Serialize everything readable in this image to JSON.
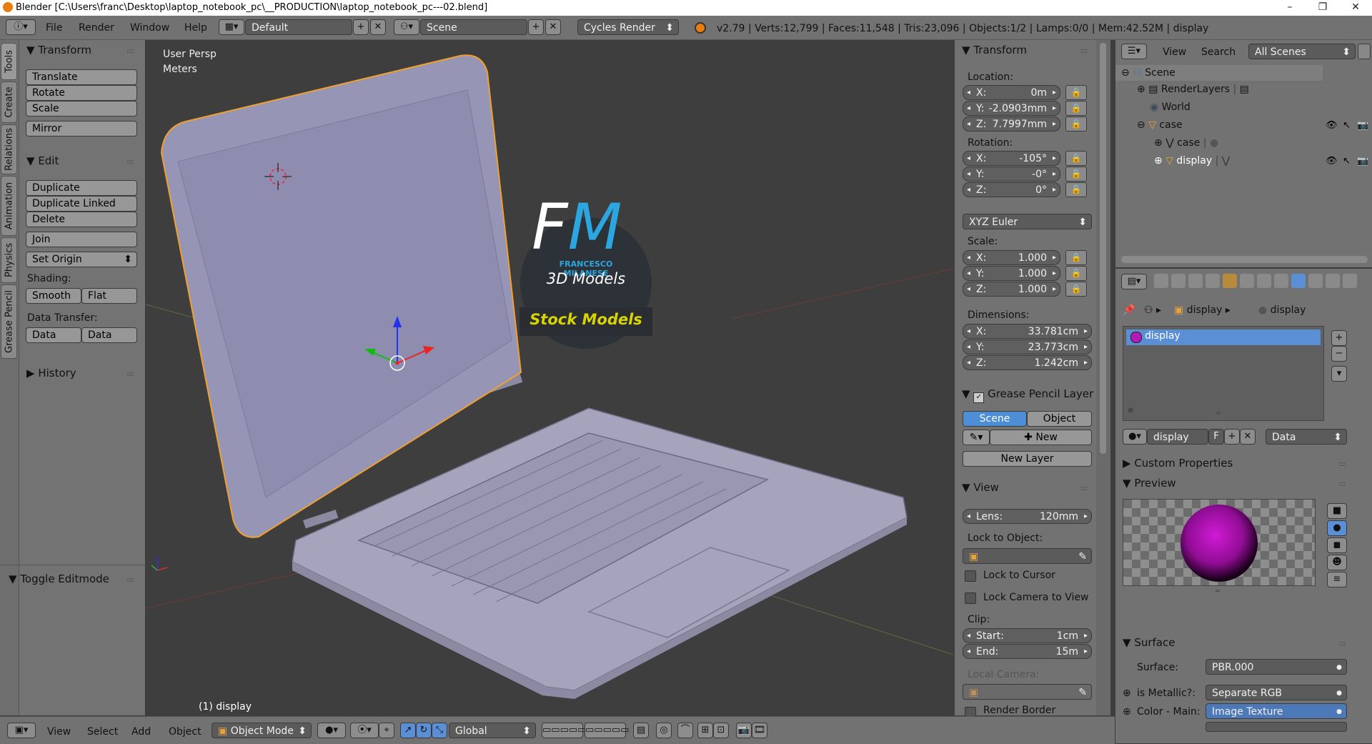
{
  "window": {
    "title": "Blender [C:\\Users\\franc\\Desktop\\laptop_notebook_pc\\__PRODUCTION\\laptop_notebook_pc---02.blend]",
    "controls": [
      "–",
      "❐",
      "✕"
    ]
  },
  "topbar": {
    "menus": [
      "File",
      "Render",
      "Window",
      "Help"
    ],
    "layout": "Default",
    "scene": "Scene",
    "engine": "Cycles Render",
    "stats": "v2.79 | Verts:12,799 | Faces:11,548 | Tris:23,096 | Objects:1/2 | Lamps:0/0 | Mem:42.52M | display"
  },
  "tabs": [
    "Tools",
    "Create",
    "Relations",
    "Animation",
    "Physics",
    "Grease Pencil"
  ],
  "toolshelf": {
    "transform_header": "Transform",
    "transform_buttons": [
      "Translate",
      "Rotate",
      "Scale"
    ],
    "mirror": "Mirror",
    "edit_header": "Edit",
    "edit_buttons": [
      "Duplicate",
      "Duplicate Linked",
      "Delete"
    ],
    "join": "Join",
    "set_origin": "Set Origin",
    "shading_label": "Shading:",
    "smooth": "Smooth",
    "flat": "Flat",
    "data_transfer_label": "Data Transfer:",
    "data": "Data",
    "data_layout": "Data Layo",
    "history": "History",
    "toggle_editmode": "Toggle Editmode"
  },
  "viewport": {
    "view_name": "User Persp",
    "units": "Meters",
    "object_label": "(1) display",
    "watermark": {
      "letters_f": "F",
      "letters_m": "M",
      "author": "FRANCESCO MILANESE",
      "subtitle": "3D Models",
      "banner": "Stock Models"
    }
  },
  "npanel": {
    "transform_header": "Transform",
    "location_label": "Location:",
    "location": [
      {
        "axis": "X:",
        "value": "0m"
      },
      {
        "axis": "Y:",
        "value": "-2.0903mm"
      },
      {
        "axis": "Z:",
        "value": "7.7997mm"
      }
    ],
    "rotation_label": "Rotation:",
    "rotation": [
      {
        "axis": "X:",
        "value": "-105°"
      },
      {
        "axis": "Y:",
        "value": "-0°"
      },
      {
        "axis": "Z:",
        "value": "0°"
      }
    ],
    "rotation_mode": "XYZ Euler",
    "scale_label": "Scale:",
    "scale": [
      {
        "axis": "X:",
        "value": "1.000"
      },
      {
        "axis": "Y:",
        "value": "1.000"
      },
      {
        "axis": "Z:",
        "value": "1.000"
      }
    ],
    "dimensions_label": "Dimensions:",
    "dimensions": [
      {
        "axis": "X:",
        "value": "33.781cm"
      },
      {
        "axis": "Y:",
        "value": "23.773cm"
      },
      {
        "axis": "Z:",
        "value": "1.242cm"
      }
    ],
    "grease_header": "Grease Pencil Layer",
    "scene_btn": "Scene",
    "object_btn": "Object",
    "new_btn": "New",
    "new_layer_btn": "New Layer",
    "view_header": "View",
    "lens_label": "Lens:",
    "lens_value": "120mm",
    "lock_to_object": "Lock to Object:",
    "lock_to_cursor": "Lock to Cursor",
    "lock_camera": "Lock Camera to View",
    "clip_label": "Clip:",
    "clip_start_label": "Start:",
    "clip_start": "1cm",
    "clip_end_label": "End:",
    "clip_end": "15m",
    "local_camera": "Local Camera:",
    "render_border": "Render Border"
  },
  "outliner": {
    "menus": [
      "View",
      "Search"
    ],
    "filter": "All Scenes",
    "tree": [
      {
        "label": "Scene"
      },
      {
        "label": "RenderLayers"
      },
      {
        "label": "World"
      },
      {
        "label": "case"
      },
      {
        "label": "case"
      },
      {
        "label": "display"
      }
    ]
  },
  "properties": {
    "breadcrumb_object": "display",
    "breadcrumb_material": "display",
    "slot": "display",
    "material_name": "display",
    "material_f": "F",
    "link": "Data",
    "custom_properties": "Custom Properties",
    "preview": "Preview",
    "surface_header": "Surface",
    "surface_label": "Surface:",
    "surface_value": "PBR.000",
    "metallic_label": "is Metallic?:",
    "metallic_value": "Separate RGB",
    "color_main_label": "Color - Main:",
    "color_main_value": "Image Texture"
  },
  "bottombar": {
    "menus": [
      "View",
      "Select",
      "Add",
      "Object"
    ],
    "mode": "Object Mode",
    "orientation": "Global"
  }
}
